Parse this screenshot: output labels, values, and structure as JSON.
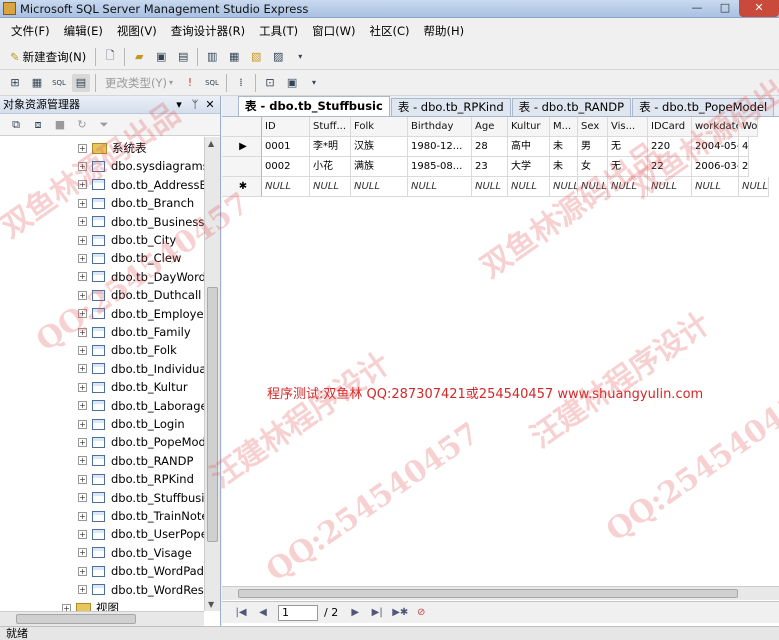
{
  "window": {
    "title": "Microsoft SQL Server Management Studio Express",
    "min": "—",
    "max": "□",
    "close": "✕"
  },
  "menu": [
    "文件(F)",
    "编辑(E)",
    "视图(V)",
    "查询设计器(R)",
    "工具(T)",
    "窗口(W)",
    "社区(C)",
    "帮助(H)"
  ],
  "toolbar": {
    "new_query": "新建查询(N)",
    "change_type": "更改类型(Y)"
  },
  "object_explorer": {
    "title": "对象资源管理器",
    "pin": "ᛘ",
    "close": "✕",
    "dropdown": "▾",
    "nodes": [
      {
        "label": "系统表",
        "kind": "folder"
      },
      {
        "label": "dbo.sysdiagrams",
        "kind": "table"
      },
      {
        "label": "dbo.tb_AddressB",
        "kind": "table"
      },
      {
        "label": "dbo.tb_Branch",
        "kind": "table"
      },
      {
        "label": "dbo.tb_Business",
        "kind": "table"
      },
      {
        "label": "dbo.tb_City",
        "kind": "table"
      },
      {
        "label": "dbo.tb_Clew",
        "kind": "table"
      },
      {
        "label": "dbo.tb_DayWord",
        "kind": "table"
      },
      {
        "label": "dbo.tb_Duthcall",
        "kind": "table"
      },
      {
        "label": "dbo.tb_Employee",
        "kind": "table"
      },
      {
        "label": "dbo.tb_Family",
        "kind": "table"
      },
      {
        "label": "dbo.tb_Folk",
        "kind": "table"
      },
      {
        "label": "dbo.tb_Individual",
        "kind": "table"
      },
      {
        "label": "dbo.tb_Kultur",
        "kind": "table"
      },
      {
        "label": "dbo.tb_Laborage",
        "kind": "table"
      },
      {
        "label": "dbo.tb_Login",
        "kind": "table"
      },
      {
        "label": "dbo.tb_PopeMod",
        "kind": "table"
      },
      {
        "label": "dbo.tb_RANDP",
        "kind": "table"
      },
      {
        "label": "dbo.tb_RPKind",
        "kind": "table"
      },
      {
        "label": "dbo.tb_Stuffbusic",
        "kind": "table"
      },
      {
        "label": "dbo.tb_TrainNote",
        "kind": "table"
      },
      {
        "label": "dbo.tb_UserPope",
        "kind": "table"
      },
      {
        "label": "dbo.tb_Visage",
        "kind": "table"
      },
      {
        "label": "dbo.tb_WordPad",
        "kind": "table"
      },
      {
        "label": "dbo.tb_WordResu",
        "kind": "table"
      },
      {
        "label": "视图",
        "kind": "folder"
      }
    ]
  },
  "tabs": [
    {
      "label": "表 - dbo.tb_Stuffbusic",
      "active": true
    },
    {
      "label": "表 - dbo.tb_RPKind",
      "active": false
    },
    {
      "label": "表 - dbo.tb_RANDP",
      "active": false
    },
    {
      "label": "表 - dbo.tb_PopeModel",
      "active": false
    }
  ],
  "grid": {
    "columns": [
      "ID",
      "Stuff...",
      "Folk",
      "Birthday",
      "Age",
      "Kultur",
      "M...",
      "Sex",
      "Vis...",
      "IDCard",
      "workdate",
      "Wo"
    ],
    "rows": [
      {
        "marker": "▶",
        "cells": [
          "0001",
          "李*明",
          "汉族",
          "1980-12...",
          "28",
          "高中",
          "未",
          "男",
          "无",
          "220",
          "2004-05-...",
          "4"
        ]
      },
      {
        "marker": "",
        "cells": [
          "0002",
          "小花",
          "满族",
          "1985-08...",
          "23",
          "大学",
          "未",
          "女",
          "无",
          "22",
          "2006-03-...",
          "2"
        ]
      },
      {
        "marker": "✱",
        "cells": [
          "NULL",
          "NULL",
          "NULL",
          "NULL",
          "NULL",
          "NULL",
          "NULL",
          "NULL",
          "NULL",
          "NULL",
          "NULL",
          "NULL"
        ]
      }
    ]
  },
  "notice": "程序测试:双鱼林 QQ:287307421或254540457 www.shuangyulin.com",
  "pager": {
    "current": "1",
    "total": "/ 2"
  },
  "status": "就绪",
  "watermarks": [
    "双鱼林源码出品",
    "QQ:254540457",
    "汪建林程序设计",
    "QQ:254540457",
    "双鱼林源码出品",
    "汪建林程序设计",
    "QQ:254540457",
    "双鱼林源码出品"
  ]
}
